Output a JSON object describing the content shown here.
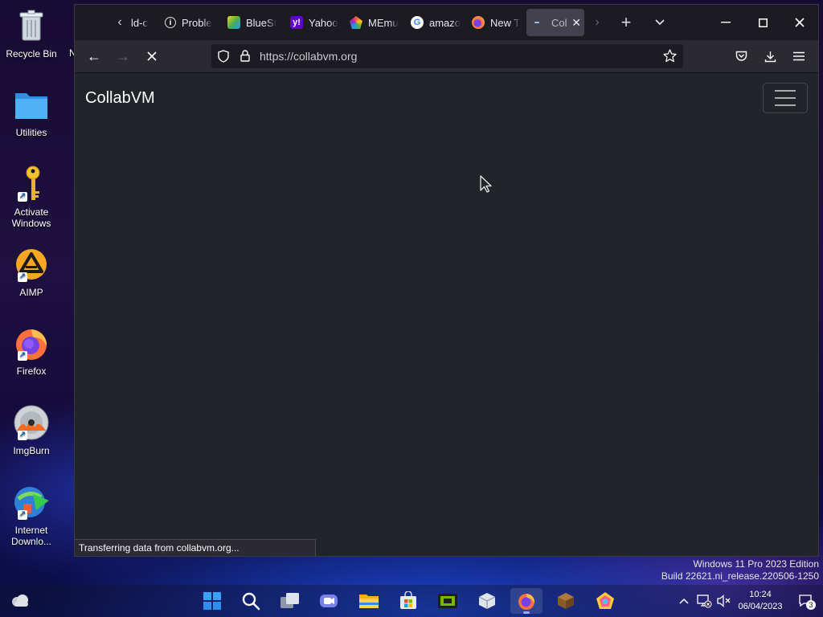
{
  "desktop": {
    "icons": [
      {
        "label": "Recycle Bin",
        "icon": "recycle-bin-icon"
      },
      {
        "label": "Utilities",
        "icon": "folder-icon"
      },
      {
        "label": "Activate Windows",
        "icon": "key-icon"
      },
      {
        "label": "AIMP",
        "icon": "aimp-icon"
      },
      {
        "label": "Firefox",
        "icon": "firefox-icon"
      },
      {
        "label": "ImgBurn",
        "icon": "imgburn-icon"
      },
      {
        "label": "Internet Downlo...",
        "icon": "internet-download-manager-icon"
      }
    ],
    "stray_label": "N"
  },
  "browser": {
    "tabs": [
      {
        "label": "ld-c",
        "favicon": "none"
      },
      {
        "label": "Proble",
        "favicon": "info-icon"
      },
      {
        "label": "BlueSt",
        "favicon": "bluestacks-icon"
      },
      {
        "label": "Yahoo",
        "favicon": "yahoo-icon"
      },
      {
        "label": "MEmu",
        "favicon": "memu-icon"
      },
      {
        "label": "amazo",
        "favicon": "google-icon"
      },
      {
        "label": "New T",
        "favicon": "firefox-icon"
      },
      {
        "label": "Col",
        "favicon": "loading-icon",
        "active": true
      }
    ],
    "url": "https://collabvm.org",
    "status_text": "Transferring data from collabvm.org...",
    "page": {
      "brand": "CollabVM"
    },
    "colors": {
      "page_bg": "#212529",
      "toolbar_bg": "#2b2a33",
      "tabstrip_bg": "#1c1b22",
      "active_tab_bg": "#42414d"
    }
  },
  "watermark": {
    "line1": "Windows 11 Pro 2023 Edition",
    "line2": "Build 22621.ni_release.220506-1250"
  },
  "taskbar": {
    "apps": [
      "start-icon",
      "search-icon",
      "task-view-icon",
      "chat-icon",
      "file-explorer-icon",
      "store-icon",
      "nvidia-icon",
      "package-icon",
      "firefox-icon",
      "minecraft-icon",
      "memu-icon"
    ],
    "active_app": "firefox-icon",
    "time": "10:24",
    "date": "06/04/2023",
    "notification_count": "3"
  }
}
